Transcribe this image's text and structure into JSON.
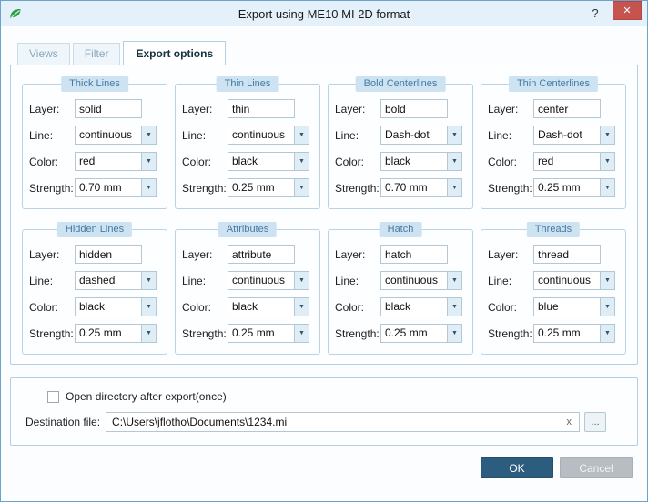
{
  "window": {
    "title": "Export using ME10 MI 2D format",
    "help_label": "?",
    "close_label": "✕"
  },
  "icons": {
    "dropdown_arrow": "▼",
    "clear_x": "x",
    "browse_ellipsis": "..."
  },
  "tabs": [
    {
      "label": "Views"
    },
    {
      "label": "Filter"
    },
    {
      "label": "Export options"
    }
  ],
  "field_labels": {
    "layer": "Layer:",
    "line": "Line:",
    "color": "Color:",
    "strength": "Strength:"
  },
  "groups": [
    {
      "title": "Thick Lines",
      "layer": "solid",
      "line": "continuous",
      "color": "red",
      "strength": "0.70 mm"
    },
    {
      "title": "Thin Lines",
      "layer": "thin",
      "line": "continuous",
      "color": "black",
      "strength": "0.25 mm"
    },
    {
      "title": "Bold Centerlines",
      "layer": "bold",
      "line": "Dash-dot",
      "color": "black",
      "strength": "0.70 mm"
    },
    {
      "title": "Thin Centerlines",
      "layer": "center",
      "line": "Dash-dot",
      "color": "red",
      "strength": "0.25 mm"
    },
    {
      "title": "Hidden Lines",
      "layer": "hidden",
      "line": "dashed",
      "color": "black",
      "strength": "0.25 mm"
    },
    {
      "title": "Attributes",
      "layer": "attribute",
      "line": "continuous",
      "color": "black",
      "strength": "0.25 mm"
    },
    {
      "title": "Hatch",
      "layer": "hatch",
      "line": "continuous",
      "color": "black",
      "strength": "0.25 mm"
    },
    {
      "title": "Threads",
      "layer": "thread",
      "line": "continuous",
      "color": "blue",
      "strength": "0.25 mm"
    }
  ],
  "footer": {
    "checkbox_label": "Open directory after export(once)",
    "destination_label": "Destination file:",
    "destination_value": "C:\\Users\\jflotho\\Documents\\1234.mi",
    "ok_label": "OK",
    "cancel_label": "Cancel"
  },
  "colors": {
    "accent_ok_button": "#2d5d7e",
    "close_button_red": "#c7534f",
    "group_badge_bg": "#cde3f2",
    "titlebar_bg": "#e4f1fa",
    "window_border": "#6da3c9"
  }
}
